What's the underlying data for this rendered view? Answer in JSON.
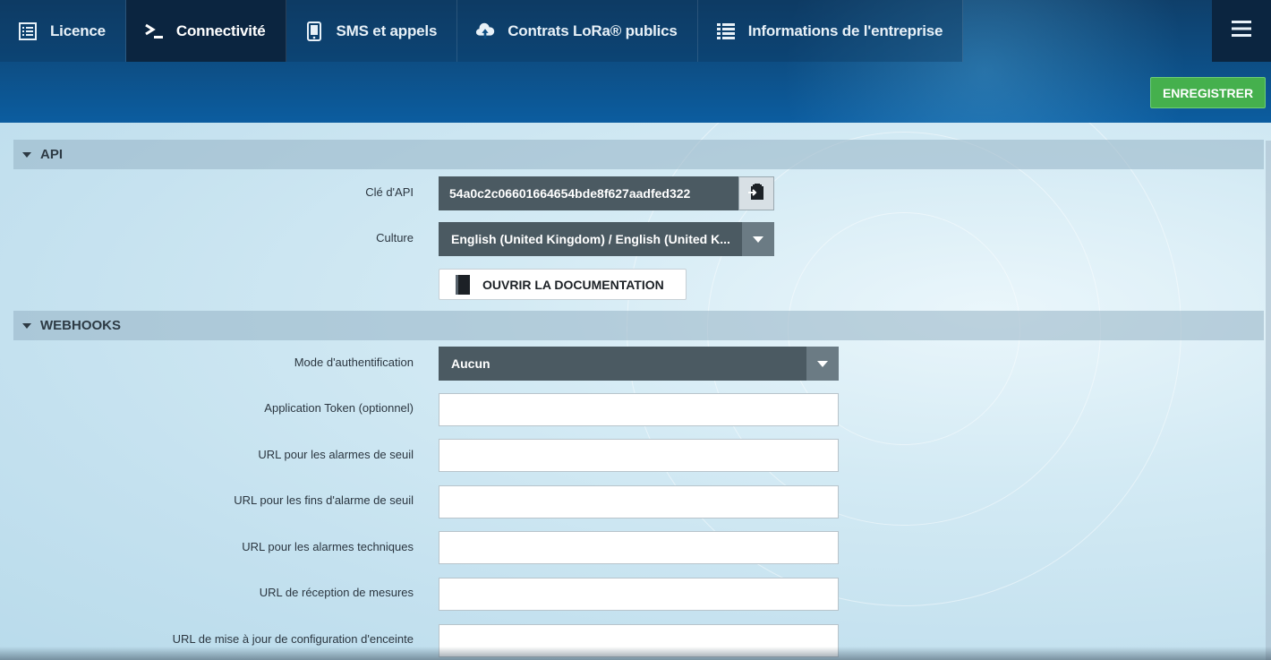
{
  "tabs": [
    {
      "label": "Licence",
      "icon": "list-document-icon"
    },
    {
      "label": "Connectivité",
      "icon": "terminal-prompt-icon",
      "active": true
    },
    {
      "label": "SMS et appels",
      "icon": "mobile-phone-icon"
    },
    {
      "label": "Contrats LoRa® publics",
      "icon": "cloud-upload-icon"
    },
    {
      "label": "Informations de l'entreprise",
      "icon": "list-icon"
    }
  ],
  "toolbar": {
    "save_label": "ENREGISTRER",
    "menu_icon": "hamburger-menu-icon"
  },
  "api": {
    "section_title": "API",
    "key_label": "Clé d'API",
    "key_value": "54a0c2c06601664654bde8f627aadfed322",
    "culture_label": "Culture",
    "culture_value": "English (United Kingdom) / English (United K...",
    "doc_button_label": "OUVRIR LA DOCUMENTATION"
  },
  "webhooks": {
    "section_title": "WEBHOOKS",
    "auth_mode_label": "Mode d'authentification",
    "auth_mode_value": "Aucun",
    "fields": [
      {
        "label": "Application Token (optionnel)",
        "value": ""
      },
      {
        "label": "URL pour les alarmes de seuil",
        "value": ""
      },
      {
        "label": "URL pour les fins d'alarme de seuil",
        "value": ""
      },
      {
        "label": "URL pour les alarmes techniques",
        "value": ""
      },
      {
        "label": "URL de réception de mesures",
        "value": ""
      },
      {
        "label": "URL de mise à jour de configuration d'enceinte",
        "value": ""
      }
    ]
  },
  "colors": {
    "accent_green": "#45b04d",
    "header_dark": "#0b2540",
    "field_dark": "#4b5a62"
  }
}
